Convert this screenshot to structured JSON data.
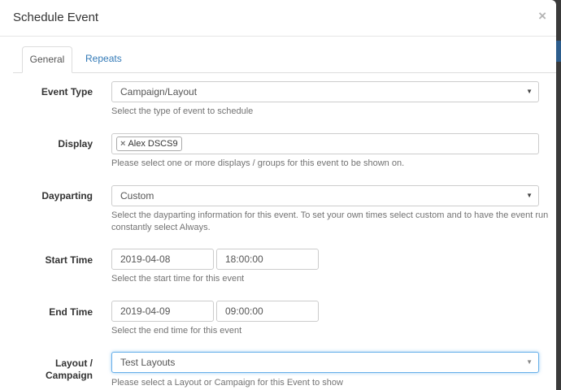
{
  "modal": {
    "title": "Schedule Event",
    "close_symbol": "×"
  },
  "tabs": [
    {
      "label": "General",
      "active": true
    },
    {
      "label": "Repeats",
      "active": false
    }
  ],
  "form": {
    "event_type": {
      "label": "Event Type",
      "value": "Campaign/Layout",
      "help": "Select the type of event to schedule"
    },
    "display": {
      "label": "Display",
      "tag": "Alex DSCS9",
      "tag_remove": "×",
      "help": "Please select one or more displays / groups for this event to be shown on."
    },
    "dayparting": {
      "label": "Dayparting",
      "value": "Custom",
      "help_line1": "Select the dayparting information for this event. To set your own times select custom and to have the event run",
      "help_line2": "constantly select Always."
    },
    "start_time": {
      "label": "Start Time",
      "date": "2019-04-08",
      "time": "18:00:00",
      "help": "Select the start time for this event"
    },
    "end_time": {
      "label": "End Time",
      "date": "2019-04-09",
      "time": "09:00:00",
      "help": "Select the end time for this event"
    },
    "layout_campaign": {
      "label_line1": "Layout /",
      "label_line2": "Campaign",
      "value": "Test Layouts",
      "help": "Please select a Layout or Campaign for this Event to show"
    }
  },
  "icons": {
    "caret": "▼"
  },
  "colors": {
    "link": "#337ab7",
    "focus": "#66afe9"
  }
}
